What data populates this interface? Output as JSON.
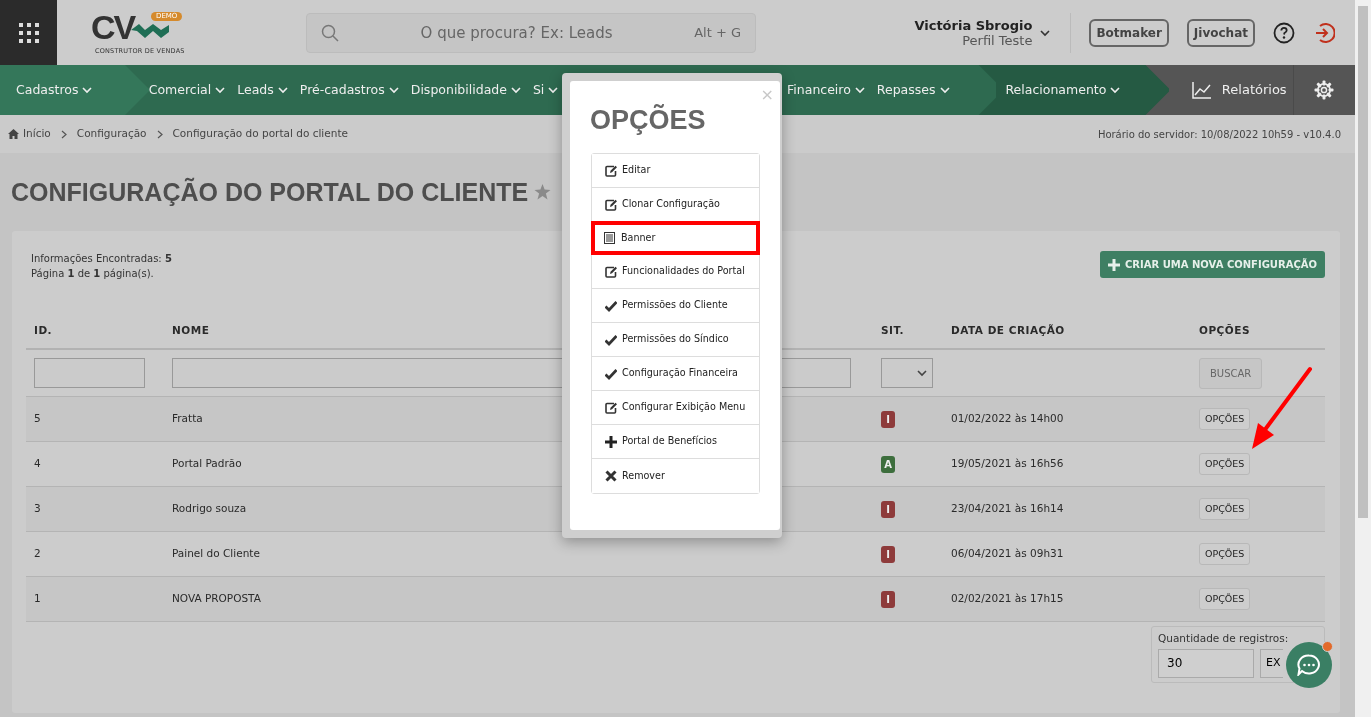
{
  "header": {
    "logo": {
      "mark": "CV",
      "badge": "DEMO",
      "tagline": "CONSTRUTOR DE VENDAS"
    },
    "search": {
      "placeholder": "O que procura? Ex: Leads",
      "shortcut": "Alt + G"
    },
    "user": {
      "name": "Victória Sbrogio",
      "profile": "Perfil Teste"
    },
    "buttons": [
      "Botmaker",
      "Jivochat"
    ]
  },
  "nav": {
    "sections": [
      {
        "items": [
          "Cadastros"
        ]
      },
      {
        "items": [
          "Comercial",
          "Leads",
          "Pré-cadastros",
          "Disponibilidade",
          "Si",
          "Financeiro",
          "Repasses"
        ]
      },
      {
        "items": [
          "Relacionamento"
        ]
      }
    ],
    "reports": "Relatórios"
  },
  "breadcrumb": {
    "items": [
      "Início",
      "Configuração",
      "Configuração do portal do cliente"
    ],
    "server_time": "Horário do servidor: 10/08/2022 10h59 - v10.4.0"
  },
  "page": {
    "title": "CONFIGURAÇÃO DO PORTAL DO CLIENTE",
    "favorite": false
  },
  "summary": [
    "Informações Encontradas: **5**",
    "Página **1** de **1** página(s)."
  ],
  "create_button": "CRIAR UMA NOVA CONFIGURAÇÃO",
  "table": {
    "columns": [
      "ID.",
      "NOME",
      "SIT.",
      "DATA DE CRIAÇÃO",
      "OPÇÕES"
    ],
    "search_button": "BUSCAR",
    "rows": [
      {
        "id": "5",
        "name": "Fratta",
        "status": "I",
        "color": "#8e3b3b",
        "created": "01/02/2022 às 14h00",
        "options": "OPÇÕES"
      },
      {
        "id": "4",
        "name": "Portal Padrão",
        "status": "A",
        "color": "#3d6e3d",
        "created": "19/05/2021 às 16h56",
        "options": "OPÇÕES"
      },
      {
        "id": "3",
        "name": "Rodrigo souza",
        "status": "I",
        "color": "#8e3b3b",
        "created": "23/04/2021 às 16h14",
        "options": "OPÇÕES"
      },
      {
        "id": "2",
        "name": "Painel do Cliente",
        "status": "I",
        "color": "#8e3b3b",
        "created": "06/04/2021 às 09h31",
        "options": "OPÇÕES"
      },
      {
        "id": "1",
        "name": "NOVA PROPOSTA",
        "status": "I",
        "color": "#8e3b3b",
        "created": "02/02/2021 às 17h15",
        "options": "OPÇÕES"
      }
    ]
  },
  "records": {
    "label": "Quantidade de registros:",
    "value": "30",
    "button": "EX"
  },
  "modal": {
    "title": "OPÇÕES",
    "close": "×",
    "options": [
      {
        "label": "Editar",
        "kind": "edit",
        "highlighted": false
      },
      {
        "label": "Clonar Configuração",
        "kind": "edit",
        "highlighted": false
      },
      {
        "label": "Banner",
        "kind": "list",
        "highlighted": true
      },
      {
        "label": "Funcionalidades do Portal",
        "kind": "edit",
        "highlighted": false
      },
      {
        "label": "Permissões do Cliente",
        "kind": "check",
        "highlighted": false
      },
      {
        "label": "Permissões do Síndico",
        "kind": "check",
        "highlighted": false
      },
      {
        "label": "Configuração Financeira",
        "kind": "check",
        "highlighted": false
      },
      {
        "label": "Configurar Exibição Menu",
        "kind": "edit",
        "highlighted": false
      },
      {
        "label": "Portal de Benefícios",
        "kind": "plus",
        "highlighted": false
      },
      {
        "label": "Remover",
        "kind": "remove",
        "highlighted": false
      }
    ]
  }
}
